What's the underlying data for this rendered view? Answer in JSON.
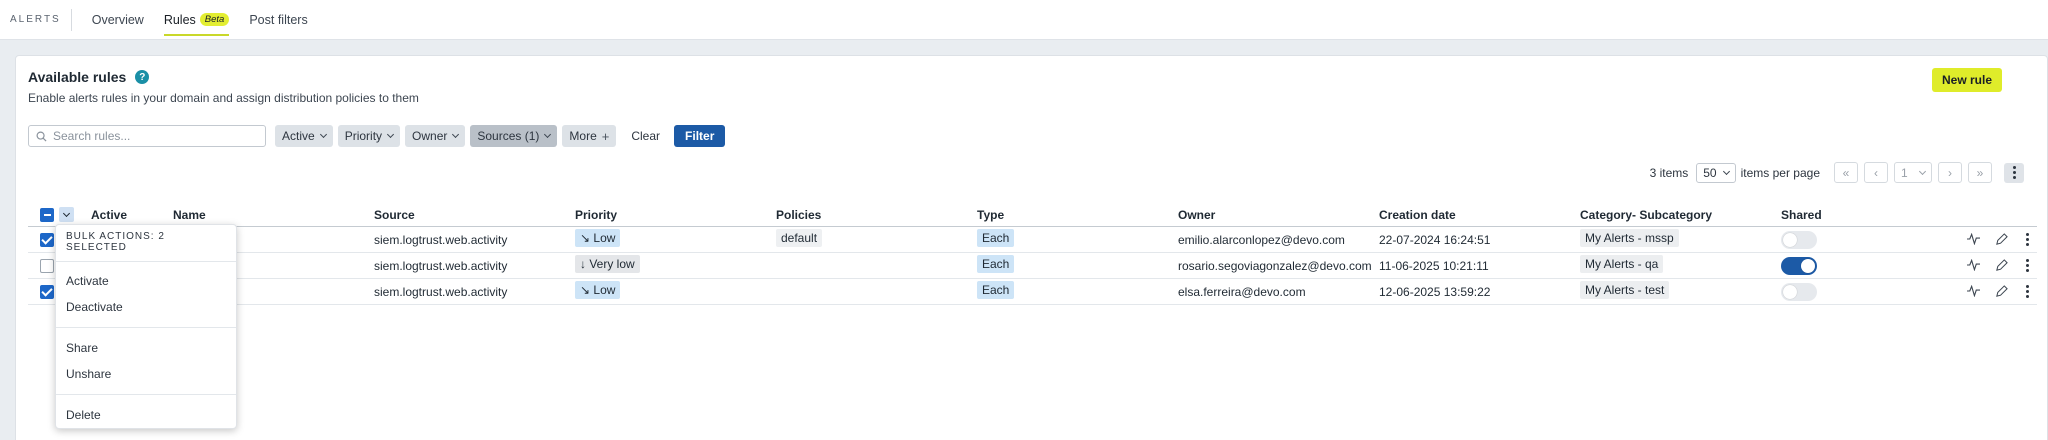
{
  "nav": {
    "brand": "ALERTS",
    "tabs": [
      {
        "label": "Overview"
      },
      {
        "label": "Rules",
        "badge": "Beta"
      },
      {
        "label": "Post filters"
      }
    ]
  },
  "panel": {
    "title": "Available rules",
    "help": "?",
    "subtitle": "Enable alerts rules in your domain and assign distribution policies to them",
    "new_rule": "New rule"
  },
  "filters": {
    "search_placeholder": "Search rules...",
    "buttons": [
      "Active",
      "Priority",
      "Owner",
      "Sources (1)"
    ],
    "more": "More",
    "more_icon": "+",
    "clear": "Clear",
    "filter": "Filter"
  },
  "pagination": {
    "items": "3 items",
    "per_page_value": "50",
    "per_page_label": "items per page",
    "page": "1",
    "first": "«",
    "prev": "‹",
    "next": "›",
    "last": "»"
  },
  "table": {
    "headers": [
      "Active",
      "Name",
      "Source",
      "Priority",
      "Policies",
      "Type",
      "Owner",
      "Creation date",
      "Category- Subcategory",
      "Shared"
    ],
    "rows": [
      {
        "checked": true,
        "source": "siem.logtrust.web.activity",
        "priority": "↘ Low",
        "priority_level": "low",
        "policies": "default",
        "type": "Each",
        "owner": "emilio.alarconlopez@devo.com",
        "created": "22-07-2024 16:24:51",
        "category": "My Alerts - mssp",
        "shared": false
      },
      {
        "checked": false,
        "source": "siem.logtrust.web.activity",
        "priority": "↓ Very low",
        "priority_level": "verylow",
        "policies": "",
        "type": "Each",
        "owner": "rosario.segoviagonzalez@devo.com",
        "created": "11-06-2025 10:21:11",
        "category": "My Alerts - qa",
        "shared": true
      },
      {
        "checked": true,
        "source": "siem.logtrust.web.activity",
        "priority": "↘ Low",
        "priority_level": "low",
        "policies": "",
        "type": "Each",
        "owner": "elsa.ferreira@devo.com",
        "created": "12-06-2025 13:59:22",
        "category": "My Alerts - test",
        "shared": false
      }
    ]
  },
  "bulk_menu": {
    "header": "BULK ACTIONS: 2 SELECTED",
    "items": [
      "Activate",
      "Deactivate",
      "Share",
      "Unshare",
      "Delete"
    ]
  },
  "colors": {
    "accent_yellow": "#dfec2a",
    "primary_blue": "#1c5aa6",
    "checkbox_blue": "#1d67c8"
  }
}
